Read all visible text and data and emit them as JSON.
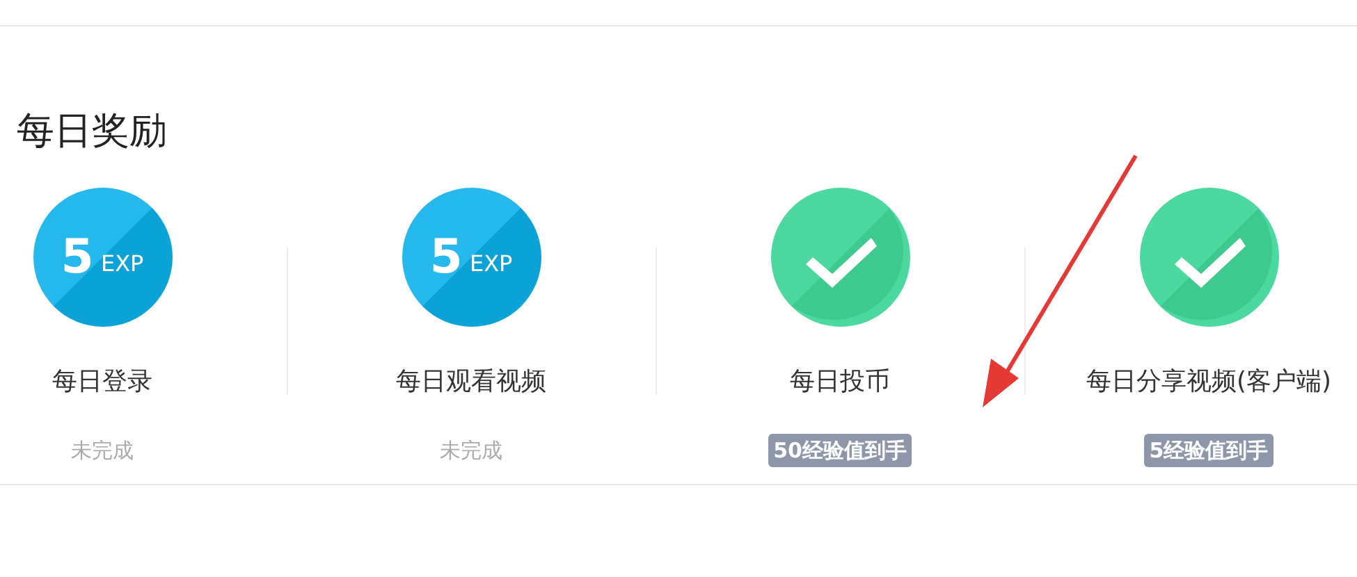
{
  "section": {
    "title": "每日奖励"
  },
  "rewards": [
    {
      "kind": "exp",
      "amount": "5",
      "unit": "EXP",
      "name": "每日登录",
      "completed": false,
      "status": "未完成"
    },
    {
      "kind": "exp",
      "amount": "5",
      "unit": "EXP",
      "name": "每日观看视频",
      "completed": false,
      "status": "未完成"
    },
    {
      "kind": "done",
      "name": "每日投币",
      "completed": true,
      "status": "50经验值到手"
    },
    {
      "kind": "done",
      "name": "每日分享视频(客户端)",
      "completed": true,
      "status": "5经验值到手"
    }
  ],
  "annotation": {
    "kind": "arrow"
  }
}
